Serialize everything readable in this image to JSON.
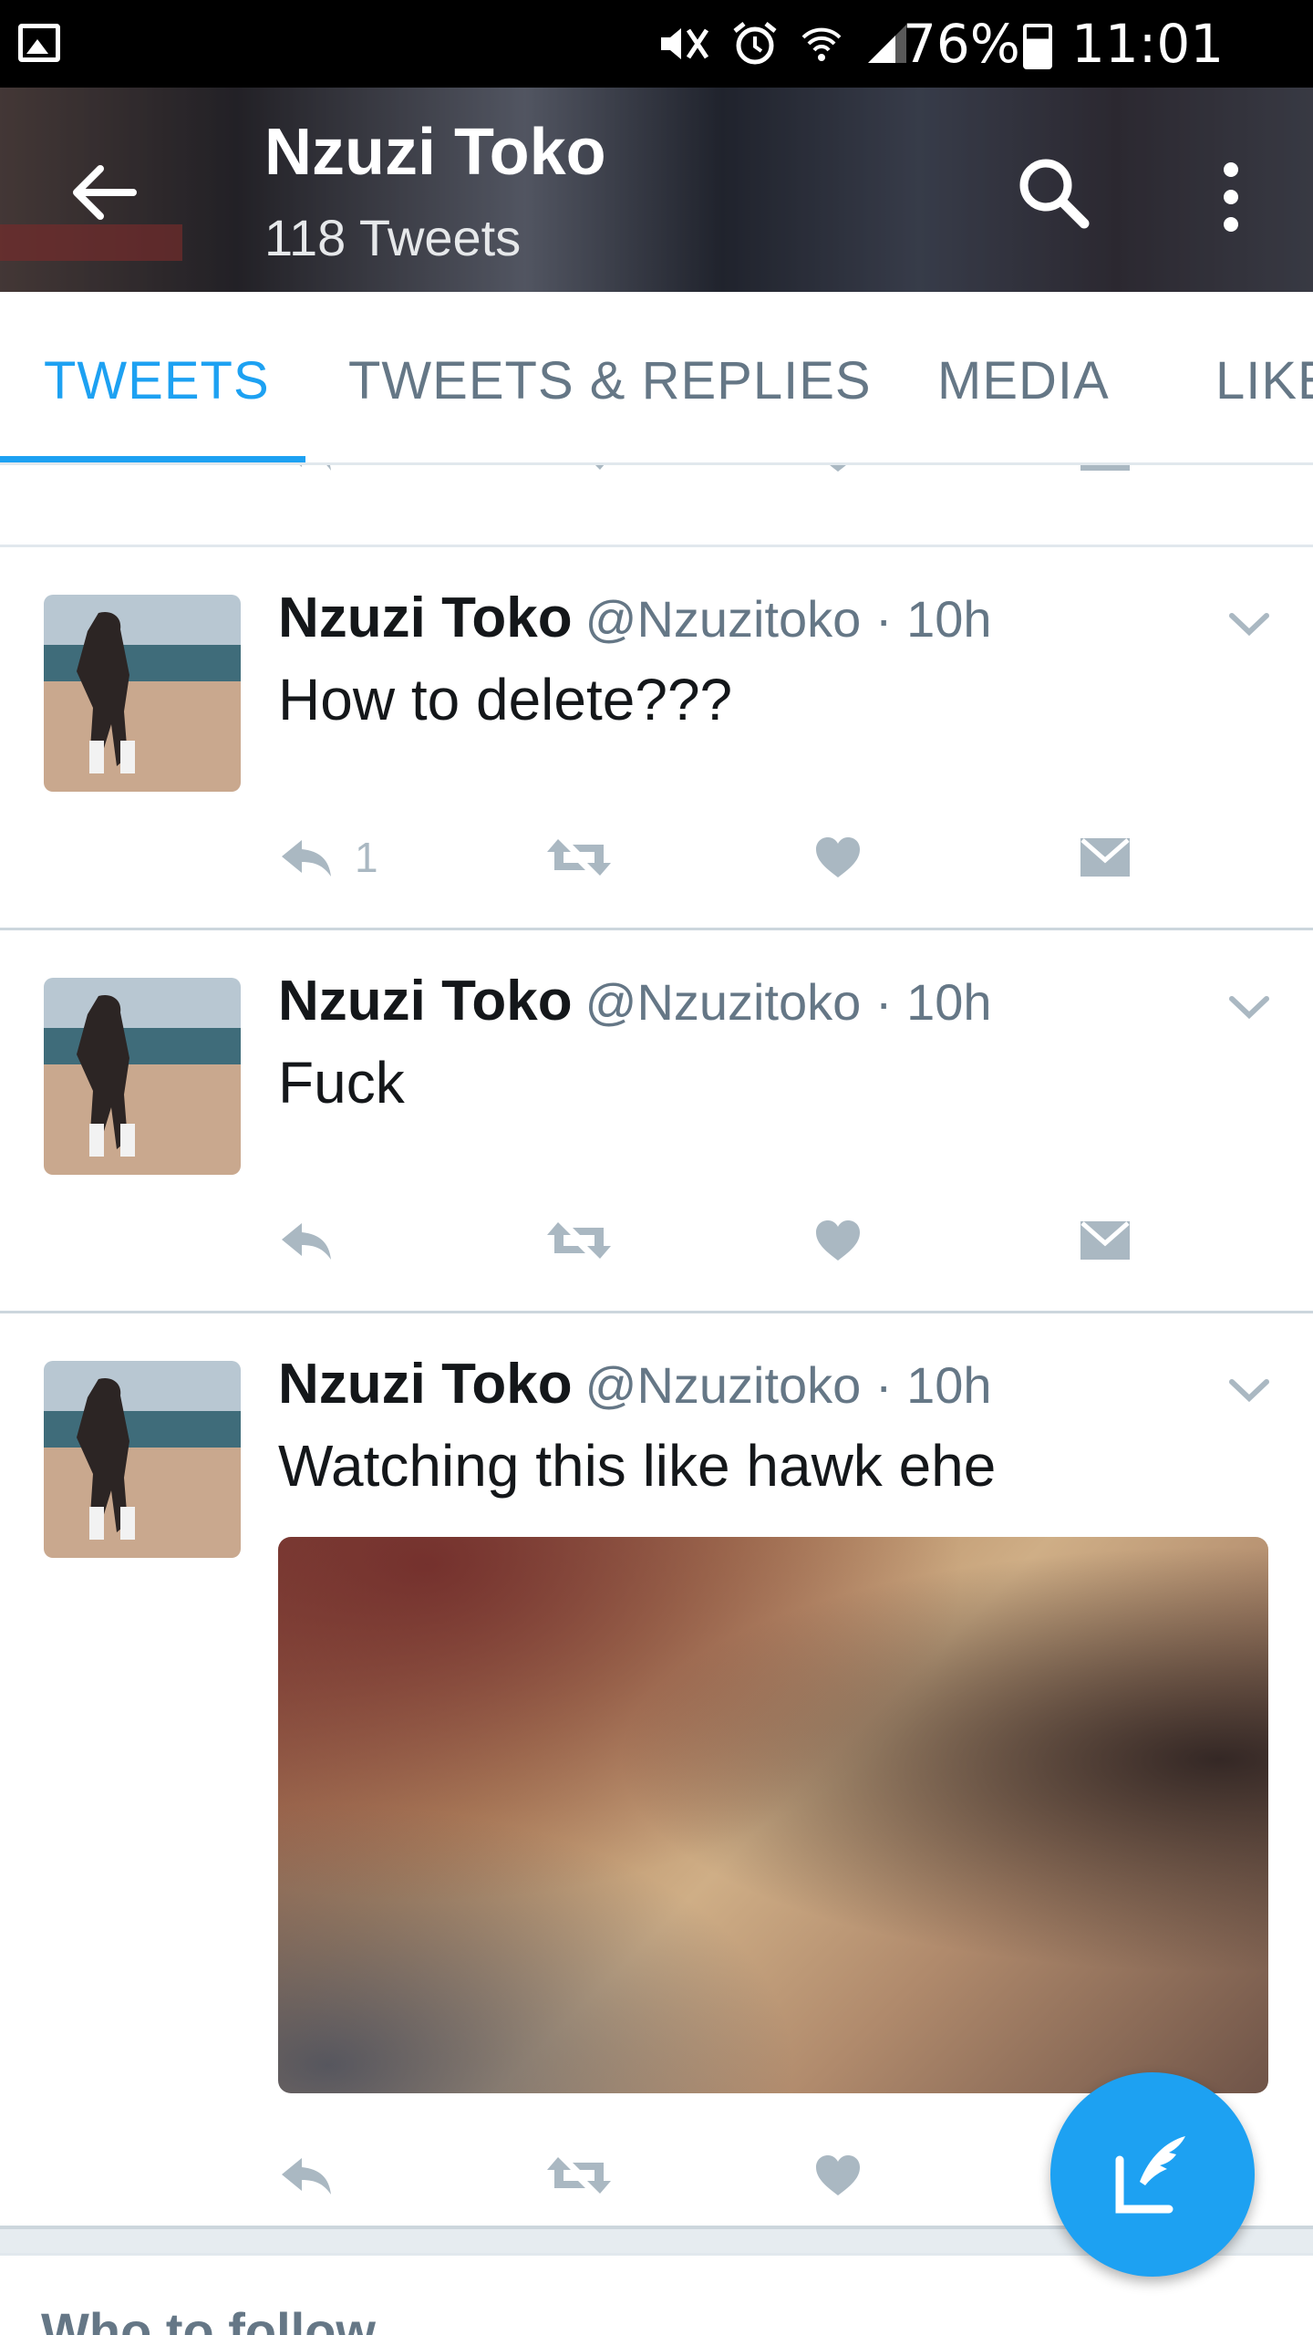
{
  "status_bar": {
    "battery_percent": "76%",
    "time": "11:01 am"
  },
  "header": {
    "title": "Nzuzi Toko",
    "tweet_count": "118 Tweets"
  },
  "tabs": [
    {
      "label": "TWEETS",
      "active": true
    },
    {
      "label": "TWEETS & REPLIES",
      "active": false
    },
    {
      "label": "MEDIA",
      "active": false
    },
    {
      "label": "LIKES",
      "active": false
    }
  ],
  "tweets": [
    {
      "name": "Nzuzi Toko",
      "meta": "@Nzuzitoko · 10h",
      "text": "How to delete???",
      "reply_count": "1"
    },
    {
      "name": "Nzuzi Toko",
      "meta": "@Nzuzitoko · 10h",
      "text": "Fuck",
      "reply_count": ""
    },
    {
      "name": "Nzuzi Toko",
      "meta": "@Nzuzitoko · 10h",
      "text": "Watching this like hawk ehe",
      "reply_count": "",
      "has_media": true
    }
  ],
  "who_to_follow": {
    "title": "Who to follow"
  },
  "colors": {
    "accent": "#1da1f2",
    "icon_gray": "#aab8c2",
    "text_secondary": "#657786"
  },
  "icons": {
    "back": "arrow-left-icon",
    "search": "search-icon",
    "more": "more-vertical-icon",
    "reply": "reply-icon",
    "retweet": "retweet-icon",
    "like": "heart-icon",
    "dm": "envelope-icon",
    "caret": "chevron-down-icon",
    "compose": "compose-icon"
  }
}
